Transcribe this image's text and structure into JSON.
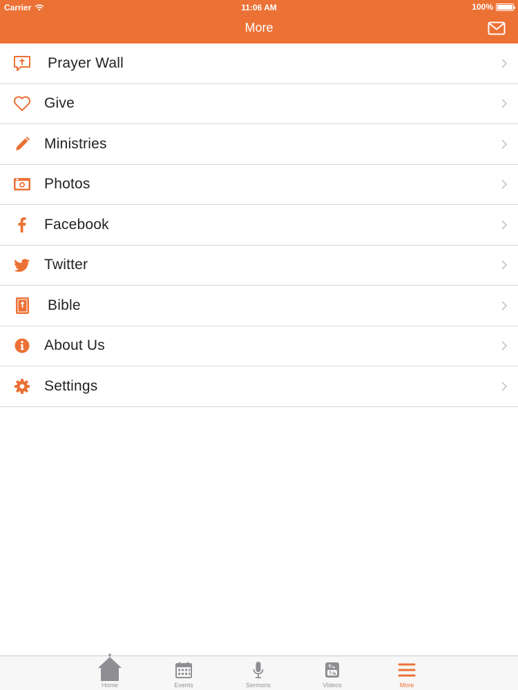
{
  "status_bar": {
    "carrier": "Carrier",
    "time": "11:06 AM",
    "battery": "100%"
  },
  "header": {
    "title": "More",
    "mail_icon": "envelope-icon"
  },
  "accent_color": "#ec7135",
  "menu": {
    "items": [
      {
        "label": "Prayer Wall",
        "icon": "prayer-bubble-icon"
      },
      {
        "label": "Give",
        "icon": "heart-icon"
      },
      {
        "label": "Ministries",
        "icon": "pencil-icon"
      },
      {
        "label": "Photos",
        "icon": "camera-icon"
      },
      {
        "label": "Facebook",
        "icon": "facebook-icon"
      },
      {
        "label": "Twitter",
        "icon": "twitter-icon"
      },
      {
        "label": "Bible",
        "icon": "bible-icon"
      },
      {
        "label": "About Us",
        "icon": "info-icon"
      },
      {
        "label": "Settings",
        "icon": "gear-icon"
      }
    ]
  },
  "tabbar": {
    "tabs": [
      {
        "label": "Home",
        "icon": "church-icon"
      },
      {
        "label": "Events",
        "icon": "calendar-icon"
      },
      {
        "label": "Sermons",
        "icon": "microphone-icon"
      },
      {
        "label": "Videos",
        "icon": "youtube-icon"
      },
      {
        "label": "More",
        "icon": "hamburger-icon",
        "active": true
      }
    ]
  }
}
